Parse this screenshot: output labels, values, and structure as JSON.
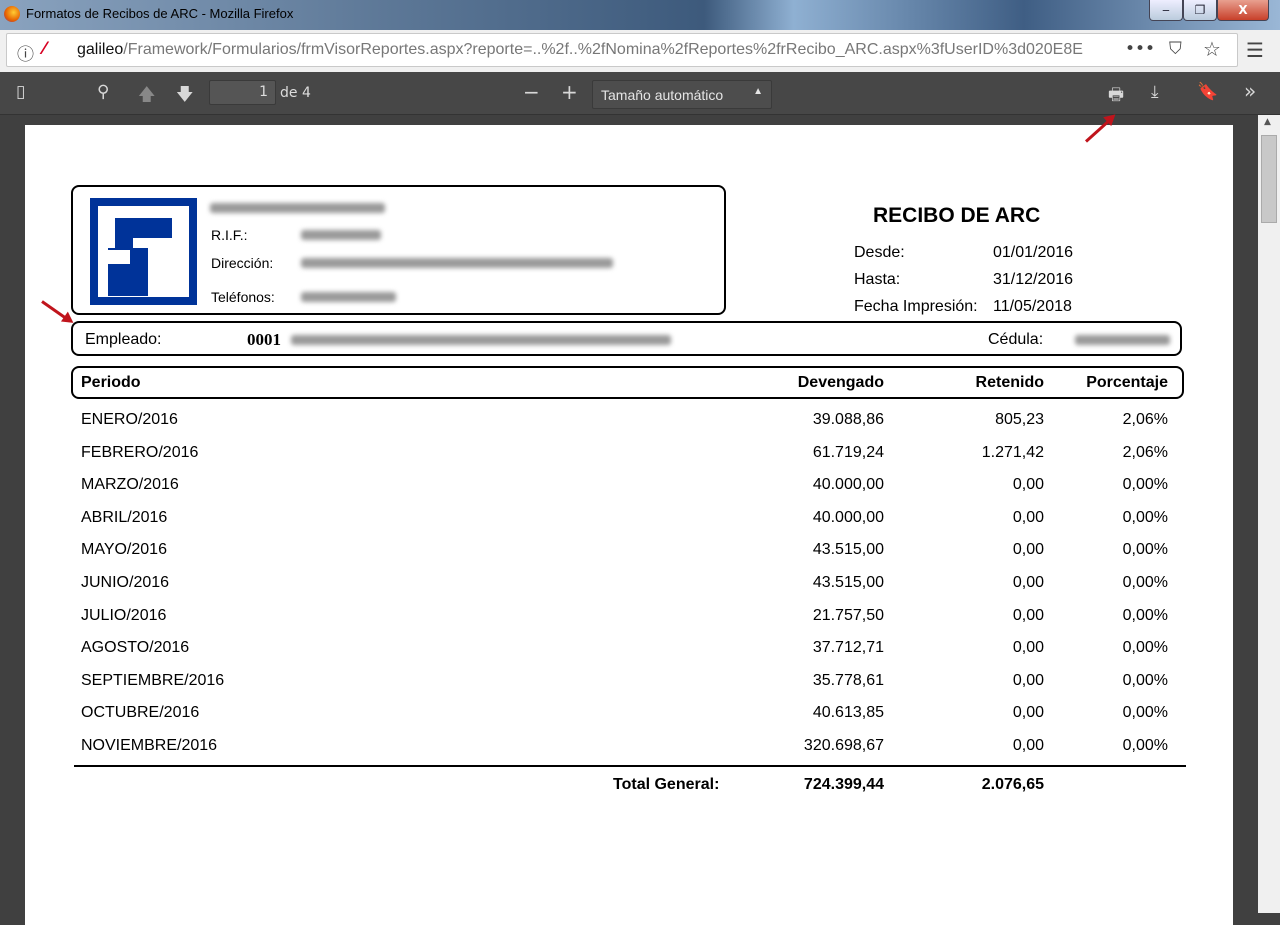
{
  "window": {
    "title": "Formatos de Recibos de ARC - Mozilla Firefox",
    "min": "‒",
    "max": "❐",
    "close": "X"
  },
  "urlbar": {
    "host": "galileo",
    "path": "/Framework/Formularios/frmVisorReportes.aspx?reporte=..%2f..%2fNomina%2fReportes%2frRecibo_ARC.aspx%3fUserID%3d020E8E"
  },
  "pdf_toolbar": {
    "page": "1",
    "of": "de 4",
    "zoom": "Tamaño automático"
  },
  "report": {
    "title": "RECIBO DE ARC",
    "rif_label": "R.I.F.:",
    "dir_label": "Dirección:",
    "tel_label": "Teléfonos:",
    "desde_label": "Desde:",
    "desde": "01/01/2016",
    "hasta_label": "Hasta:",
    "hasta": "31/12/2016",
    "fecha_label": "Fecha Impresión:",
    "fecha": "11/05/2018",
    "empleado_label": "Empleado:",
    "empleado_code": "0001",
    "cedula_label": "Cédula:",
    "headers": [
      "Periodo",
      "Devengado",
      "Retenido",
      "Porcentaje"
    ],
    "rows": [
      [
        "ENERO/2016",
        "39.088,86",
        "805,23",
        "2,06%"
      ],
      [
        "FEBRERO/2016",
        "61.719,24",
        "1.271,42",
        "2,06%"
      ],
      [
        "MARZO/2016",
        "40.000,00",
        "0,00",
        "0,00%"
      ],
      [
        "ABRIL/2016",
        "40.000,00",
        "0,00",
        "0,00%"
      ],
      [
        "MAYO/2016",
        "43.515,00",
        "0,00",
        "0,00%"
      ],
      [
        "JUNIO/2016",
        "43.515,00",
        "0,00",
        "0,00%"
      ],
      [
        "JULIO/2016",
        "21.757,50",
        "0,00",
        "0,00%"
      ],
      [
        "AGOSTO/2016",
        "37.712,71",
        "0,00",
        "0,00%"
      ],
      [
        "SEPTIEMBRE/2016",
        "35.778,61",
        "0,00",
        "0,00%"
      ],
      [
        "OCTUBRE/2016",
        "40.613,85",
        "0,00",
        "0,00%"
      ],
      [
        "NOVIEMBRE/2016",
        "320.698,67",
        "0,00",
        "0,00%"
      ]
    ],
    "total_label": "Total General:",
    "total_devengado": "724.399,44",
    "total_retenido": "2.076,65"
  }
}
